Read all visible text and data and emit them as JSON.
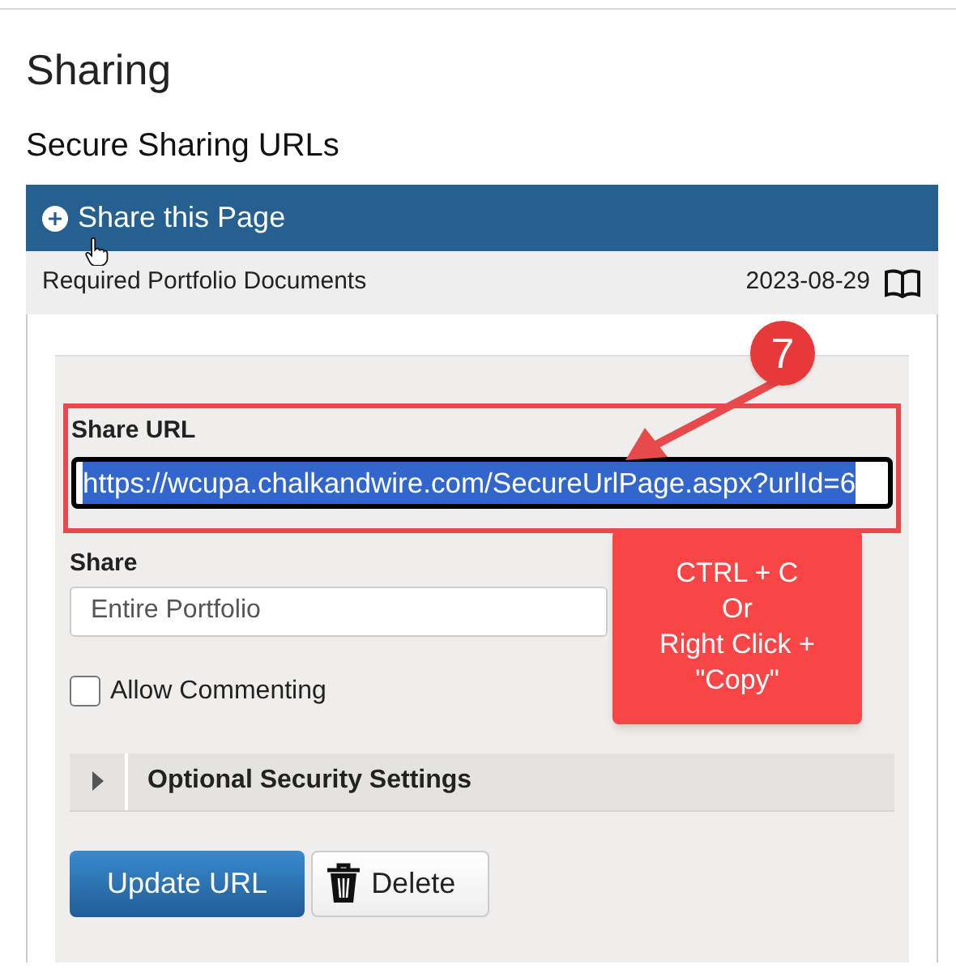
{
  "page_title": "Sharing",
  "section_title": "Secure Sharing URLs",
  "panel": {
    "title": "Share this Page",
    "expanded": true
  },
  "document_row": {
    "name": "Required Portfolio Documents",
    "date": "2023-08-29"
  },
  "share_url": {
    "label": "Share URL",
    "value": "https://wcupa.chalkandwire.com/SecureUrlPage.aspx?urlId=6",
    "selected": true
  },
  "share": {
    "label": "Share",
    "value": "Entire Portfolio"
  },
  "allow_commenting": {
    "label": "Allow Commenting",
    "checked": false
  },
  "optional_security": {
    "label": "Optional Security Settings",
    "expanded": false
  },
  "buttons": [
    {
      "label": "Update URL",
      "kind": "primary"
    },
    {
      "label": "Delete",
      "kind": "delete"
    }
  ],
  "annotation": {
    "step": "7",
    "callout": "CTRL + C\nOr\nRight Click +\n\"Copy\""
  }
}
